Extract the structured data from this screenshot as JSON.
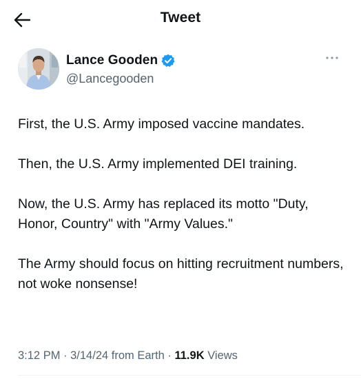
{
  "header": {
    "title": "Tweet",
    "back_icon": "arrow-left-icon"
  },
  "author": {
    "display_name": "Lance Gooden",
    "handle": "@Lancegooden",
    "verified_icon": "verified-badge-icon",
    "verified_color": "#1d9bf0",
    "more_icon": "more-horizontal-icon"
  },
  "tweet": {
    "paragraphs": [
      "First, the U.S. Army imposed vaccine mandates.",
      "Then, the U.S. Army implemented DEI training.",
      "Now, the U.S. Army has replaced its motto \"Duty, Honor, Country\" with \"Army Values.\"",
      "The Army should focus on hitting recruitment numbers, not woke nonsense!"
    ]
  },
  "meta": {
    "time": "3:12 PM",
    "separator": " · ",
    "date": "3/14/24",
    "source": "from Earth",
    "views_count": "11.9K",
    "views_label": "Views"
  },
  "colors": {
    "text_primary": "#0f1419",
    "text_secondary": "#536471",
    "accent": "#1d9bf0",
    "divider": "#eff3f4"
  }
}
